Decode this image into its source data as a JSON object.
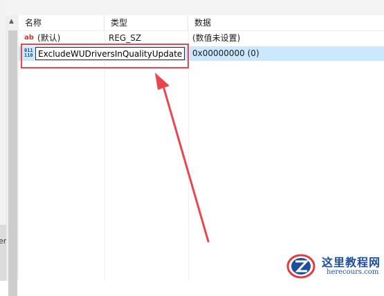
{
  "header": {
    "name_label": "名称",
    "type_label": "类型",
    "data_label": "数据"
  },
  "rows": [
    {
      "icon": "string-value-icon",
      "icon_text": "ab",
      "name": "(默认)",
      "type": "REG_SZ",
      "data": "(数值未设置)"
    },
    {
      "icon": "binary-value-icon",
      "icon_text": "011 110",
      "name": "ExcludeWUDriversInQualityUpdate",
      "type": "",
      "data": "0x00000000 (0)"
    }
  ],
  "left_pane": {
    "clipped_text": "er"
  },
  "watermark": {
    "title": "这里教程网",
    "url": "herecours.com"
  },
  "colors": {
    "selection": "#cce8ff",
    "highlight": "#e8454f",
    "brand": "#1f4e9c"
  }
}
